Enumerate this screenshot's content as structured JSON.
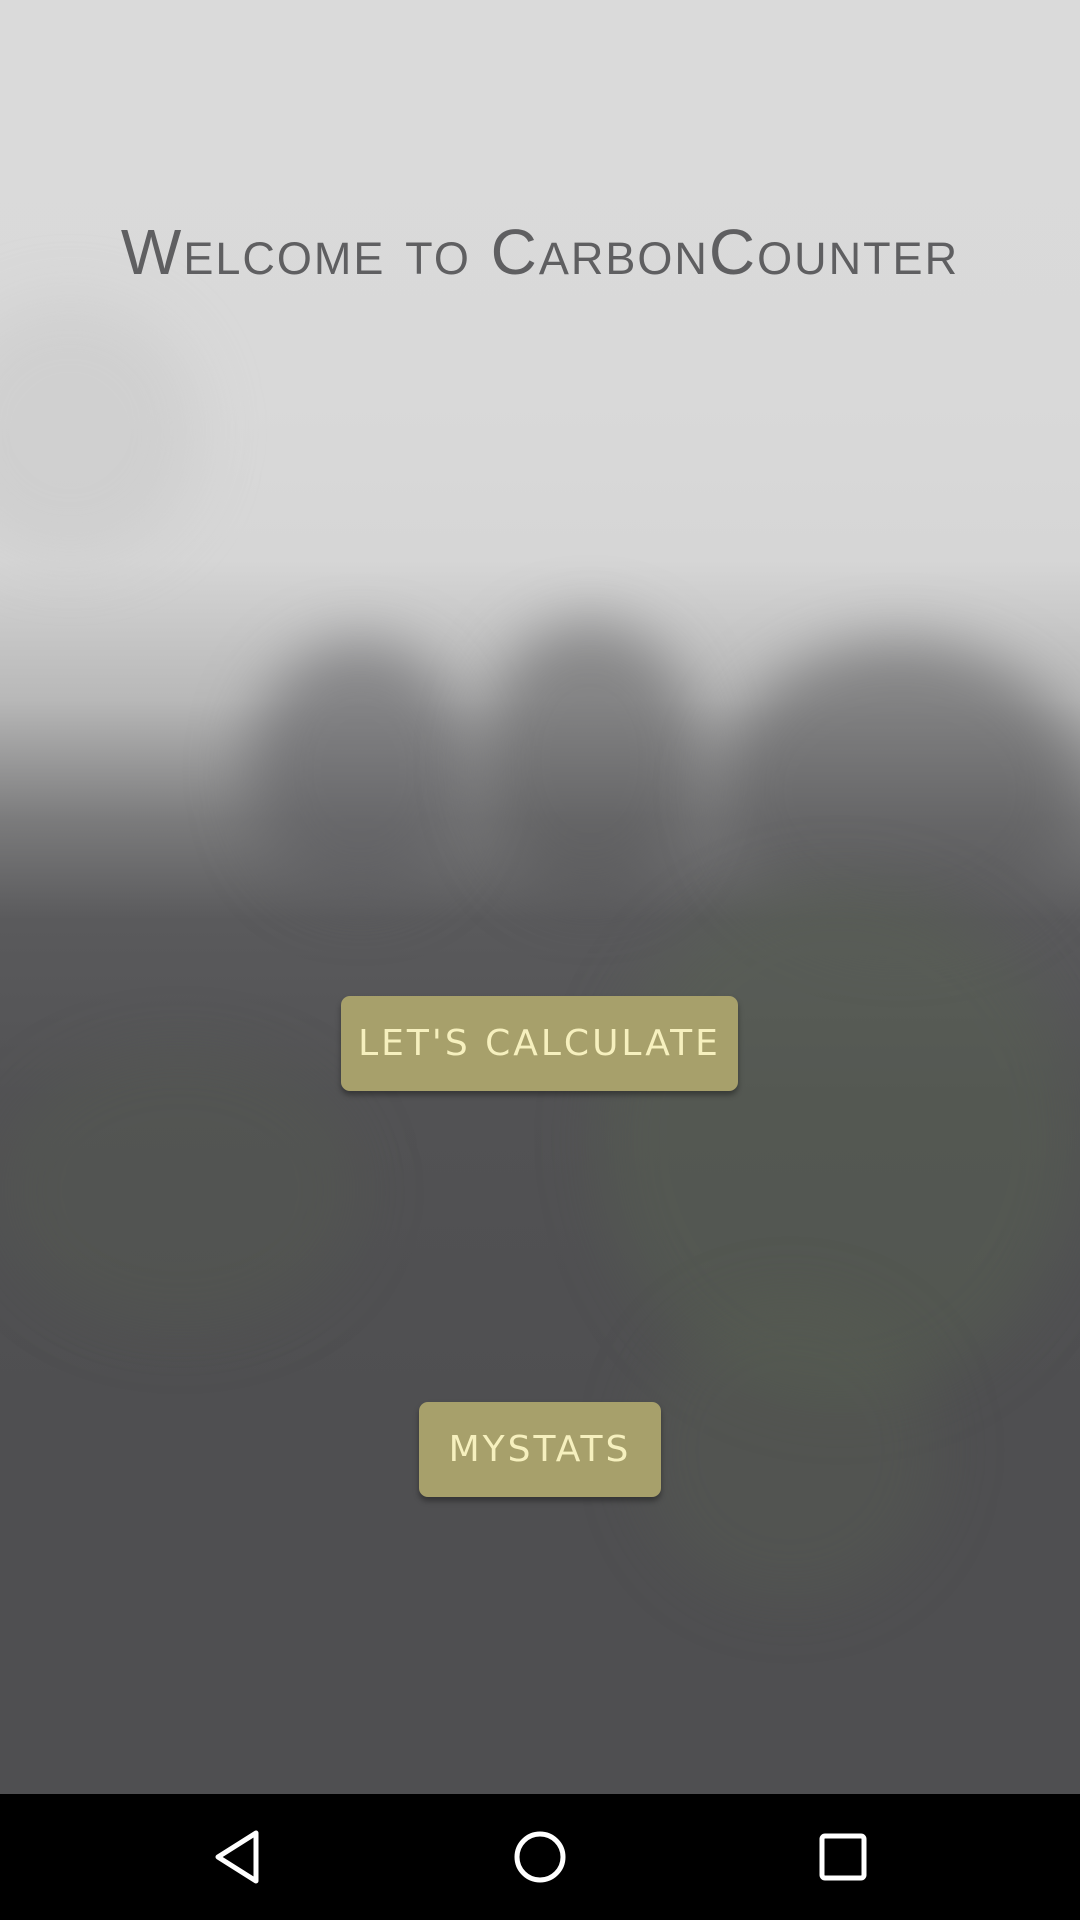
{
  "app": {
    "title": "Welcome to CarbonCounter"
  },
  "actions": {
    "calculate_label": "Let's Calculate",
    "mystats_label": "MyStats"
  },
  "navbar": {
    "back_icon": "back-triangle-icon",
    "home_icon": "home-circle-icon",
    "recents_icon": "recents-square-icon"
  },
  "colors": {
    "button_bg": "#a7a06b",
    "button_text": "#f6f0be",
    "title_text": "#5f5f61",
    "navbar_bg": "#000000"
  }
}
